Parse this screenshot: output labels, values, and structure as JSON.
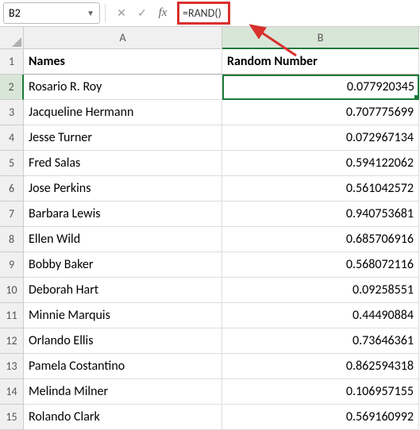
{
  "nameBox": "B2",
  "formula": "=RAND()",
  "columns": {
    "a": "A",
    "b": "B"
  },
  "headers": {
    "names": "Names",
    "random": "Random Number"
  },
  "rows": [
    {
      "n": "1"
    },
    {
      "n": "2",
      "name": "Rosario R. Roy",
      "val": "0.077920345"
    },
    {
      "n": "3",
      "name": "Jacqueline Hermann",
      "val": "0.707775699"
    },
    {
      "n": "4",
      "name": "Jesse Turner",
      "val": "0.072967134"
    },
    {
      "n": "5",
      "name": "Fred Salas",
      "val": "0.594122062"
    },
    {
      "n": "6",
      "name": "Jose Perkins",
      "val": "0.561042572"
    },
    {
      "n": "7",
      "name": "Barbara Lewis",
      "val": "0.940753681"
    },
    {
      "n": "8",
      "name": "Ellen Wild",
      "val": "0.685706916"
    },
    {
      "n": "9",
      "name": "Bobby Baker",
      "val": "0.568072116"
    },
    {
      "n": "10",
      "name": "Deborah Hart",
      "val": "0.09258551"
    },
    {
      "n": "11",
      "name": "Minnie Marquis",
      "val": "0.44490884"
    },
    {
      "n": "12",
      "name": "Orlando Ellis",
      "val": "0.73646361"
    },
    {
      "n": "13",
      "name": "Pamela Costantino",
      "val": "0.862594318"
    },
    {
      "n": "14",
      "name": "Melinda Milner",
      "val": "0.106957155"
    },
    {
      "n": "15",
      "name": "Rolando Clark",
      "val": "0.569160992"
    }
  ],
  "annotation": {
    "highlight_target": "formula-input",
    "arrow_color": "#d9302d"
  }
}
